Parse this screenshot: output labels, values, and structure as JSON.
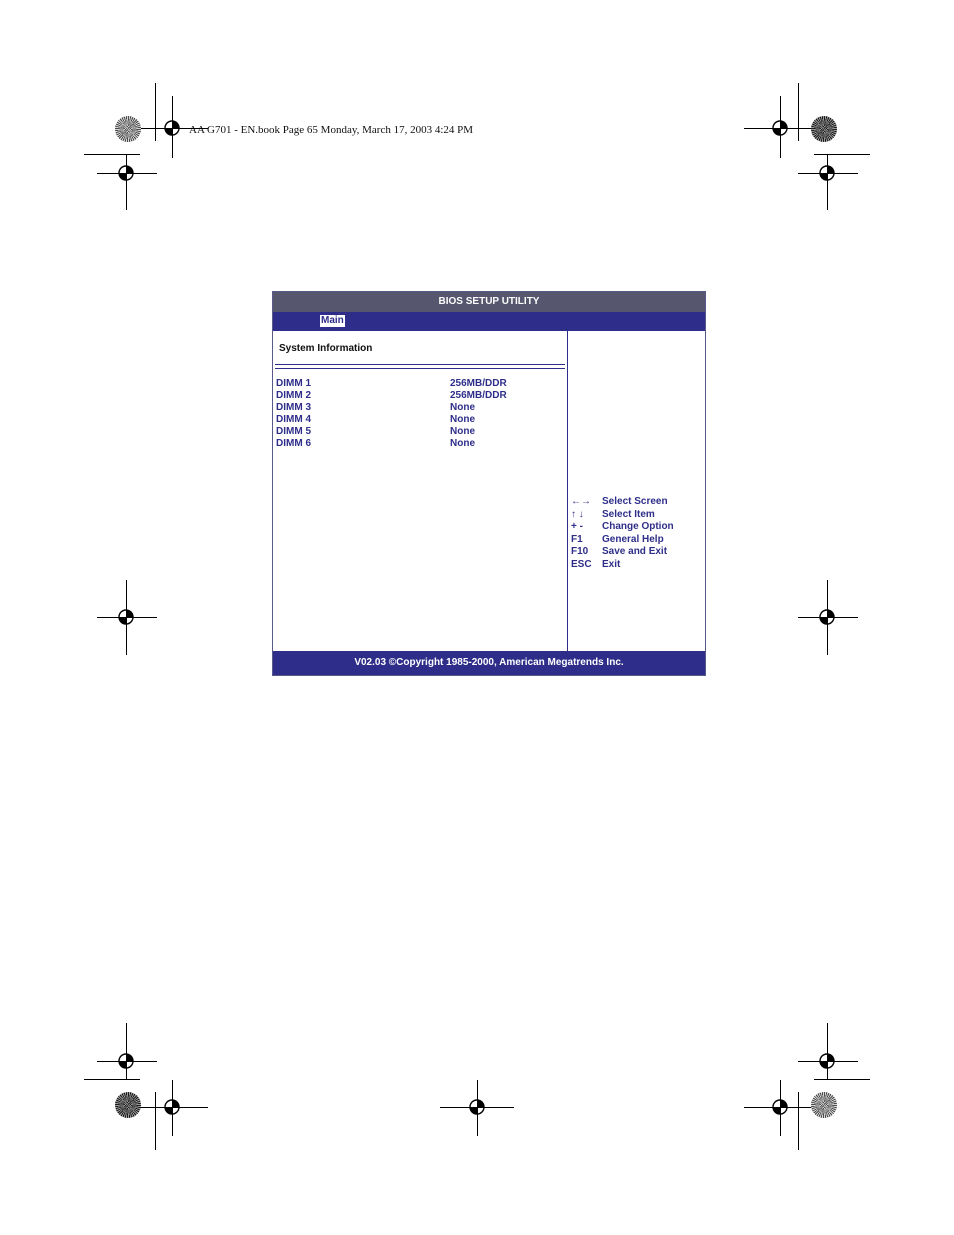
{
  "page_header": "AA G701 - EN.book  Page 65  Monday, March 17, 2003  4:24 PM",
  "bios": {
    "title": "BIOS SETUP UTILITY",
    "tabs": [
      {
        "label": "Main",
        "selected": true
      }
    ],
    "section_title": "System Information",
    "dimms": [
      {
        "name": "DIMM 1",
        "value": "256MB/DDR"
      },
      {
        "name": "DIMM 2",
        "value": "256MB/DDR"
      },
      {
        "name": "DIMM 3",
        "value": "None"
      },
      {
        "name": "DIMM 4",
        "value": "None"
      },
      {
        "name": "DIMM 5",
        "value": "None"
      },
      {
        "name": "DIMM 6",
        "value": "None"
      }
    ],
    "help": [
      {
        "key": "←→",
        "label": "Select Screen"
      },
      {
        "key": "↑ ↓",
        "label": "Select Item"
      },
      {
        "key": "+ -",
        "label": "Change Option"
      },
      {
        "key": "F1",
        "label": "General Help"
      },
      {
        "key": "F10",
        "label": "Save and Exit"
      },
      {
        "key": "ESC",
        "label": "Exit"
      }
    ],
    "footer": "V02.03 ©Copyright 1985-2000, American Megatrends Inc.",
    "colors": {
      "title_bar": "#56566f",
      "menu_bar": "#2e2e8a",
      "text": "#2e2e8a"
    }
  },
  "marks": {
    "crosshair_icon": "registration-mark-icon",
    "star_icon": "color-target-icon"
  }
}
